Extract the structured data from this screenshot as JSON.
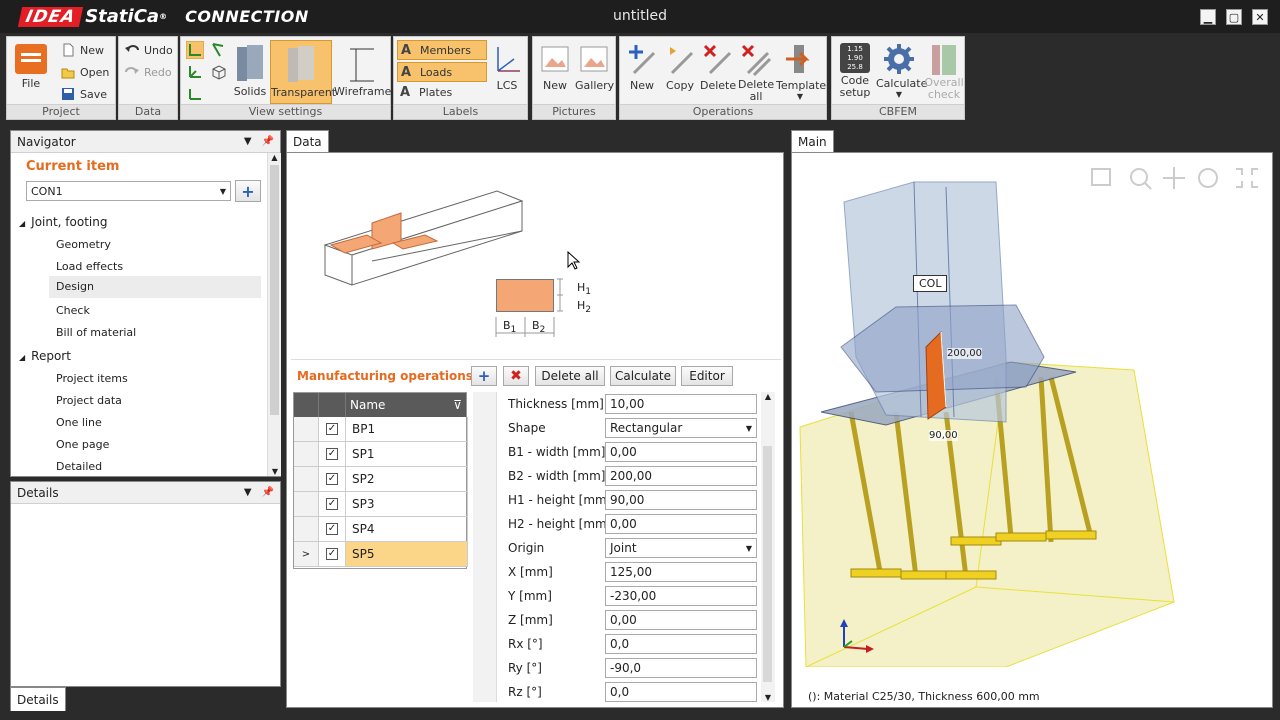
{
  "app": {
    "logo_idea": "IDEA",
    "logo_statica": "StatiCa",
    "logo_reg": "®",
    "module": "CONNECTION",
    "window_title": "untitled"
  },
  "window_controls": {
    "minimize": "▁",
    "maximize": "▢",
    "close": "✕"
  },
  "ribbon": {
    "project": {
      "label": "Project",
      "file": "File",
      "new": "New",
      "open": "Open",
      "save": "Save"
    },
    "data": {
      "label": "Data",
      "undo": "Undo",
      "redo": "Redo"
    },
    "view_settings": {
      "label": "View settings",
      "solids": "Solids",
      "transparent": "Transparent",
      "wireframe": "Wireframe"
    },
    "labels": {
      "label": "Labels",
      "members": "Members",
      "loads": "Loads",
      "plates": "Plates",
      "lcs": "LCS"
    },
    "pictures": {
      "label": "Pictures",
      "new": "New",
      "gallery": "Gallery"
    },
    "operations": {
      "label": "Operations",
      "new": "New",
      "copy": "Copy",
      "delete": "Delete",
      "delete_all_1": "Delete",
      "delete_all_2": "all",
      "template": "Template"
    },
    "cbfem": {
      "label": "CBFEM",
      "code_setup_1": "Code",
      "code_setup_2": "setup",
      "code_icon_text_1": "1.15",
      "code_icon_text_2": "1.90",
      "code_icon_text_3": "25.8",
      "calculate": "Calculate",
      "overall_1": "Overall",
      "overall_2": "check"
    }
  },
  "navigator": {
    "title": "Navigator",
    "current_item": "Current item",
    "selected": "CON1",
    "joint": "Joint, footing",
    "joint_items": [
      "Geometry",
      "Load effects",
      "Design",
      "Check",
      "Bill of material"
    ],
    "report": "Report",
    "report_items": [
      "Project items",
      "Project data",
      "One line",
      "One page",
      "Detailed"
    ]
  },
  "details": {
    "title": "Details",
    "tab": "Details"
  },
  "data_panel": {
    "tab": "Data",
    "sketch": {
      "h1": "H",
      "h1_sub": "1",
      "h2": "H",
      "h2_sub": "2",
      "b1": "B",
      "b1_sub": "1",
      "b2": "B",
      "b2_sub": "2"
    },
    "mo_title": "Manufacturing operations",
    "buttons": {
      "delete_all": "Delete all",
      "calculate": "Calculate",
      "editor": "Editor"
    },
    "table_header": "Name",
    "rows": [
      "BP1",
      "SP1",
      "SP2",
      "SP3",
      "SP4",
      "SP5"
    ],
    "selected_row": "SP5",
    "properties": [
      {
        "label": "Thickness [mm]",
        "value": "10,00"
      },
      {
        "label": "Shape",
        "value": "Rectangular",
        "dropdown": true
      },
      {
        "label": "B1 - width [mm]",
        "value": "0,00"
      },
      {
        "label": "B2 - width [mm]",
        "value": "200,00"
      },
      {
        "label": "H1 - height [mm]",
        "value": "90,00"
      },
      {
        "label": "H2 - height [mm]",
        "value": "0,00"
      },
      {
        "label": "Origin",
        "value": "Joint",
        "dropdown": true
      },
      {
        "label": "X [mm]",
        "value": "125,00"
      },
      {
        "label": "Y [mm]",
        "value": "-230,00"
      },
      {
        "label": "Z [mm]",
        "value": "0,00"
      },
      {
        "label": "Rx [°]",
        "value": "0,0"
      },
      {
        "label": "Ry [°]",
        "value": "-90,0"
      },
      {
        "label": "Rz [°]",
        "value": "0,0"
      }
    ]
  },
  "main_panel": {
    "tab": "Main",
    "col_label": "COL",
    "dim_200": "200,00",
    "dim_90": "90,00",
    "status": "(): Material C25/30, Thickness 600,00 mm"
  },
  "colors": {
    "accent": "#e46b1f",
    "plate": "#f4a775",
    "active_btn": "#f7c26b"
  }
}
